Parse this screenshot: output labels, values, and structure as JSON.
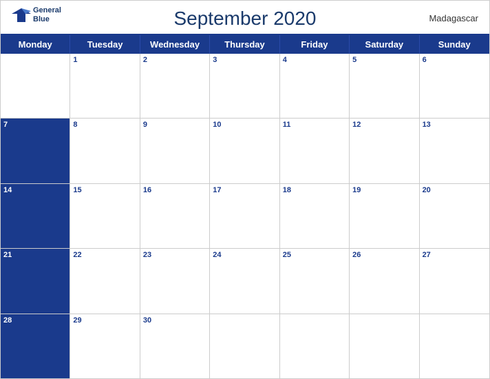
{
  "header": {
    "title": "September 2020",
    "country": "Madagascar",
    "logo": {
      "line1": "General",
      "line2": "Blue"
    }
  },
  "days_of_week": [
    "Monday",
    "Tuesday",
    "Wednesday",
    "Thursday",
    "Friday",
    "Saturday",
    "Sunday"
  ],
  "weeks": [
    [
      {
        "date": "",
        "empty": true
      },
      {
        "date": "1"
      },
      {
        "date": "2"
      },
      {
        "date": "3"
      },
      {
        "date": "4"
      },
      {
        "date": "5"
      },
      {
        "date": "6"
      }
    ],
    [
      {
        "date": "7",
        "monday": true
      },
      {
        "date": "8"
      },
      {
        "date": "9"
      },
      {
        "date": "10"
      },
      {
        "date": "11"
      },
      {
        "date": "12"
      },
      {
        "date": "13"
      }
    ],
    [
      {
        "date": "14",
        "monday": true
      },
      {
        "date": "15"
      },
      {
        "date": "16"
      },
      {
        "date": "17"
      },
      {
        "date": "18"
      },
      {
        "date": "19"
      },
      {
        "date": "20"
      }
    ],
    [
      {
        "date": "21",
        "monday": true
      },
      {
        "date": "22"
      },
      {
        "date": "23"
      },
      {
        "date": "24"
      },
      {
        "date": "25"
      },
      {
        "date": "26"
      },
      {
        "date": "27"
      }
    ],
    [
      {
        "date": "28",
        "monday": true
      },
      {
        "date": "29"
      },
      {
        "date": "30"
      },
      {
        "date": "",
        "empty": true
      },
      {
        "date": "",
        "empty": true
      },
      {
        "date": "",
        "empty": true
      },
      {
        "date": "",
        "empty": true
      }
    ]
  ]
}
